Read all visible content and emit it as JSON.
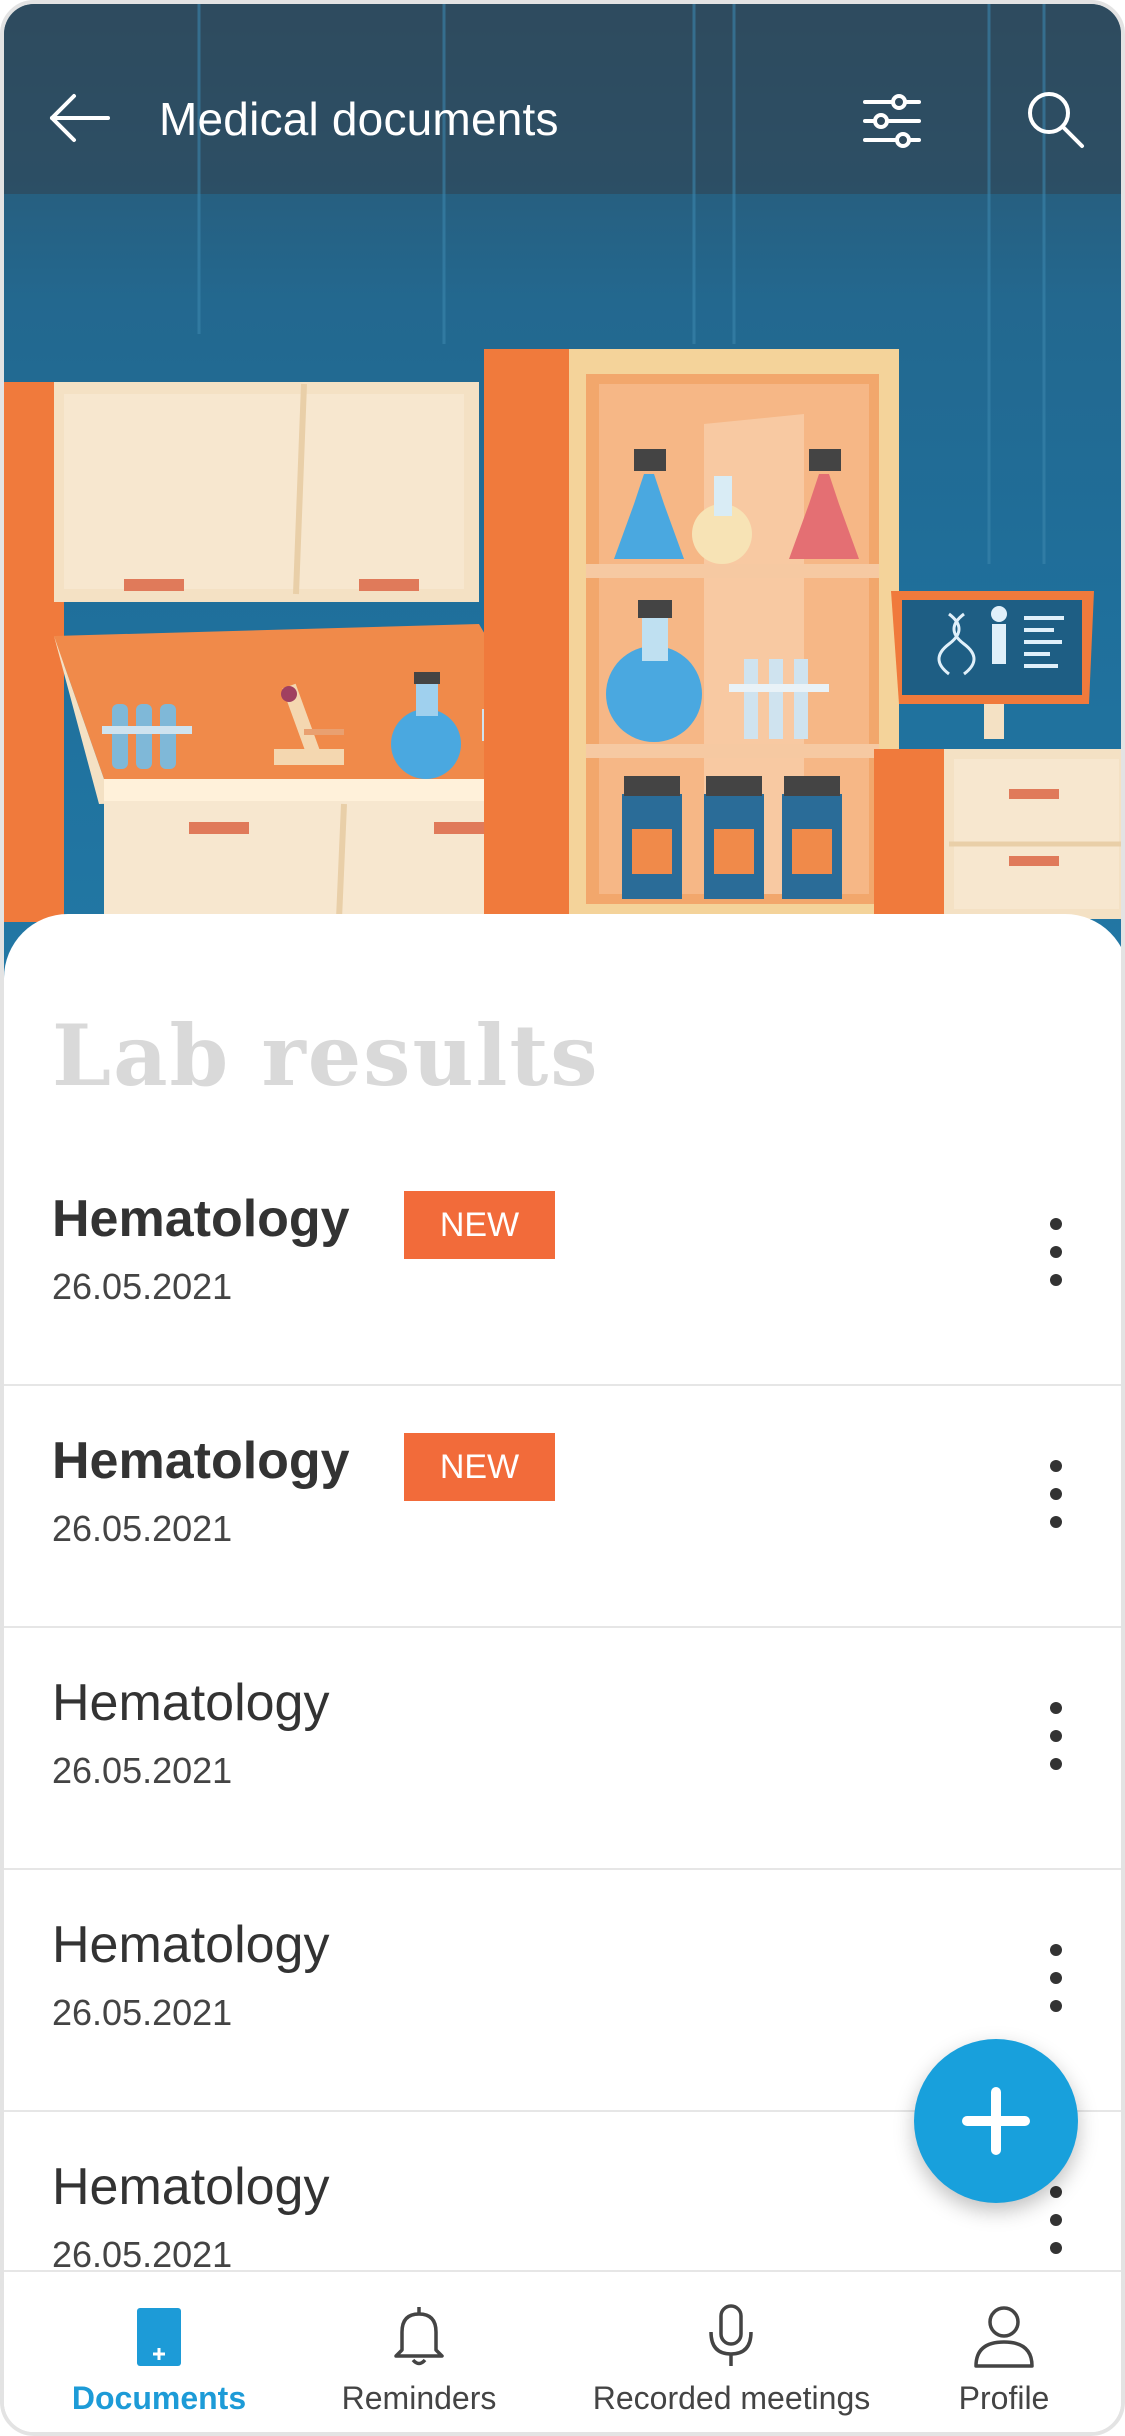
{
  "header": {
    "title": "Medical documents",
    "back_icon": "arrow-left-icon",
    "filter_icon": "sliders-icon",
    "search_icon": "search-icon"
  },
  "section": {
    "title": "Lab results"
  },
  "documents": [
    {
      "title": "Hematology",
      "date": "26.05.2021",
      "badge": "NEW",
      "is_new": true
    },
    {
      "title": "Hematology",
      "date": "26.05.2021",
      "badge": "NEW",
      "is_new": true
    },
    {
      "title": "Hematology",
      "date": "26.05.2021",
      "is_new": false
    },
    {
      "title": "Hematology",
      "date": "26.05.2021",
      "is_new": false
    },
    {
      "title": "Hematology",
      "date": "26.05.2021",
      "is_new": false
    }
  ],
  "fab": {
    "icon": "plus-icon"
  },
  "bottom_nav": {
    "active": "Documents",
    "items": [
      {
        "label": "Documents",
        "icon": "document-icon"
      },
      {
        "label": "Reminders",
        "icon": "bell-icon"
      },
      {
        "label": "Recorded meetings",
        "icon": "microphone-icon"
      },
      {
        "label": "Profile",
        "icon": "user-icon"
      }
    ]
  },
  "colors": {
    "accent": "#18a0dc",
    "badge": "#f26b3a",
    "header_bg": "#23688f"
  }
}
